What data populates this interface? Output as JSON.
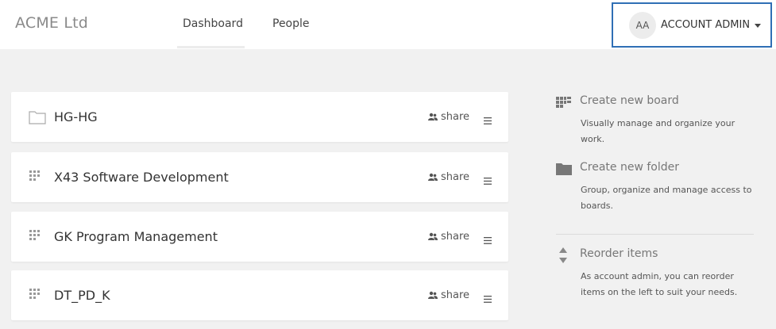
{
  "header": {
    "brand": "ACME Ltd",
    "nav": [
      {
        "label": "Dashboard",
        "active": true
      },
      {
        "label": "People",
        "active": false
      }
    ],
    "account": {
      "initials": "AA",
      "label": "ACCOUNT ADMIN"
    }
  },
  "items": [
    {
      "title": "HG-HG",
      "icon": "folder-icon",
      "share_label": "share"
    },
    {
      "title": "X43 Software Development",
      "icon": "board-drag-icon",
      "share_label": "share"
    },
    {
      "title": "GK Program Management",
      "icon": "board-drag-icon",
      "share_label": "share"
    },
    {
      "title": "DT_PD_K",
      "icon": "board-drag-icon",
      "share_label": "share"
    }
  ],
  "sidebar": {
    "create_board": {
      "title": "Create new board",
      "description": "Visually manage and organize your work."
    },
    "create_folder": {
      "title": "Create new folder",
      "description": "Group, organize and manage access to boards."
    },
    "reorder": {
      "title": "Reorder items",
      "description": "As account admin, you can reorder items on the left to suit your needs."
    }
  },
  "colors": {
    "accent_border": "#2f6fb5",
    "background": "#f1f1f1"
  }
}
